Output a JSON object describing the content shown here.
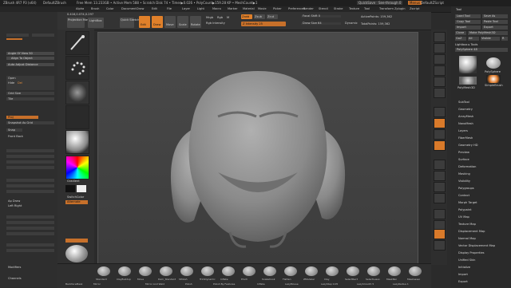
{
  "title_bar": {
    "app": "ZBrush 4R7 P3 (x64)",
    "doc": "DefaultZBrush",
    "mem": "Free Mem 13.233GB • Active Mem 588 • Scratch Disk 74 • Timer▶0.026 • PolyCount▶159.28 KP • MeshCount▶1",
    "quicksave": "QuickSave",
    "seethrough": "See-through 0",
    "menus": "Menus",
    "script": "DefaultZScript"
  },
  "menubar": [
    "Alpha",
    "Brush",
    "Color",
    "Document",
    "Draw",
    "Edit",
    "File",
    "Layer",
    "Light",
    "Macro",
    "Marker",
    "Material",
    "Movie",
    "Picker",
    "Preferences",
    "Render",
    "Stencil",
    "Stroke",
    "Texture",
    "Tool",
    "Transform",
    "Zplugin",
    "Zscript"
  ],
  "toolbar": {
    "coords": "0.416,0.074,0.297",
    "projection_master": "Projection Master",
    "lightbox": "LightBox",
    "quick_sketch": "Quick Sketch",
    "edit": "Edit",
    "draw": "Draw",
    "move": "Move",
    "scale": "Scale",
    "rotate": "Rotate",
    "mrgb": "Mrgb",
    "rgb": "Rgb",
    "m": "M",
    "zadd": "Zadd",
    "zsub": "Zsub",
    "zcut": "Zcut",
    "rgb_intensity": "Rgb Intensity",
    "z_intensity": "Z Intensity 25",
    "focal_shift": "Focal Shift 0",
    "draw_size": "Draw Size 64",
    "dynamic": "Dynamic",
    "active_points": "ActivePoints: 159,362",
    "total_points": "TotalPoints: 159,362"
  },
  "left_panel": {
    "items": [
      "Mask",
      "Smt",
      "Angle Of View 50",
      "Align To Object",
      "Auto Adjust Distance",
      "Open",
      "Hide",
      "Del",
      "Grid Size",
      "Tile",
      "Proj",
      "Snapshot As Grid",
      "Snap",
      "Front Back",
      "Tile Proportional",
      "X",
      "Y",
      "Z",
      "Horizontal Offset",
      "Vertical Offset",
      "Tile Size",
      "Ap Draw",
      "Left Right",
      "Ap Gradient",
      "Horizontal Offset",
      "Vertical Offset",
      "Tile Size",
      "Modifiers",
      "Channels"
    ]
  },
  "left_tools": {
    "gradient": "Gradient",
    "switchcolor": "SwitchColor",
    "alternate": "Alternate",
    "sculptris": "Sculptris Pro",
    "dot": "Dot"
  },
  "right_panel": {
    "header": "Tool",
    "buttons": [
      "Load Tool",
      "Save As",
      "Copy Tool",
      "Paste Tool",
      "Import",
      "Export",
      "Clone",
      "Make PolyMesh3D",
      "GoZ",
      "All",
      "Visible",
      "R"
    ],
    "lightbox_tools": "Lightbox ▸ Tools",
    "polysphere": "PolySphere 48",
    "thumb_labels": [
      "PolySphere",
      "SimpleBrush",
      "PolyMesh3D"
    ],
    "sections": [
      "SubTool",
      "Geometry",
      "ArrayMesh",
      "NanoMesh",
      "Layers",
      "FiberMesh",
      "Geometry HD",
      "Preview",
      "Surface",
      "Deformation",
      "Masking",
      "Visibility",
      "Polygroups",
      "Contact",
      "Morph Target",
      "Polypaint",
      "UV Map",
      "Texture Map",
      "Displacement Map",
      "Normal Map",
      "Vector Displacement Map",
      "Display Properties",
      "Unified Skin",
      "Initialize",
      "Import",
      "Export"
    ]
  },
  "bottom_bar": {
    "brushes": [
      "Standard",
      "ClayBuildup",
      "Move",
      "Dam_Standard",
      "hPolish",
      "TrimDynamic",
      "Inflate",
      "Pinch",
      "Snakehook",
      "Flatten",
      "ZModeler",
      "Clay",
      "SelectRect",
      "SelectLasso",
      "MaskPen",
      "MaskLasso"
    ],
    "labels": {
      "backface": "BackfaceMask",
      "mirror": "Mirror",
      "mirror_weld": "Mirror And Weld",
      "polish": "Polish",
      "polish_features": "Polish By Features",
      "inflate": "Inflate",
      "lazymouse": "LazyMouse",
      "lazystep": "LazyStep 0.05",
      "lazysmooth": "LazySmooth 5",
      "lazyradius": "LazyRadius 1"
    }
  },
  "colors": {
    "accent": "#e0802a",
    "panel": "#2e2e2e",
    "canvas": "#464646",
    "mesh": "#8e8e8e"
  }
}
